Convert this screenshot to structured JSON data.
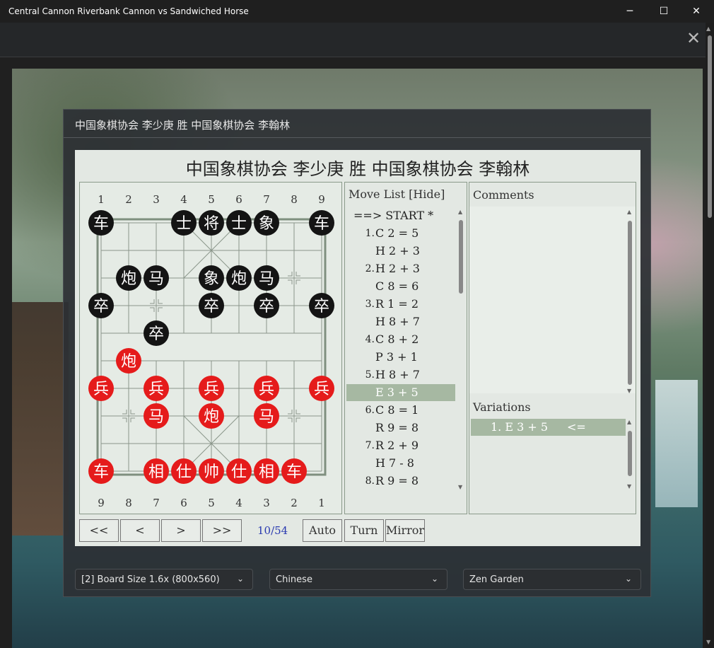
{
  "window": {
    "title": "Central Cannon Riverbank Cannon vs Sandwiched Horse",
    "minimize_glyph": "─",
    "maximize_glyph": "☐",
    "close_glyph": "✕"
  },
  "viewer": {
    "close_glyph": "✕",
    "dialog_title": "中国象棋协会 李少庚 胜 中国象棋协会 李翰林",
    "game_title": "中国象棋协会 李少庚 胜 中国象棋协会 李翰林"
  },
  "board": {
    "top_labels": [
      "1",
      "2",
      "3",
      "4",
      "5",
      "6",
      "7",
      "8",
      "9"
    ],
    "bottom_labels": [
      "9",
      "8",
      "7",
      "6",
      "5",
      "4",
      "3",
      "2",
      "1"
    ],
    "pieces": [
      {
        "color": "black",
        "char": "车",
        "file": 0,
        "rank": 0
      },
      {
        "color": "black",
        "char": "士",
        "file": 3,
        "rank": 0
      },
      {
        "color": "black",
        "char": "将",
        "file": 4,
        "rank": 0
      },
      {
        "color": "black",
        "char": "士",
        "file": 5,
        "rank": 0
      },
      {
        "color": "black",
        "char": "象",
        "file": 6,
        "rank": 0
      },
      {
        "color": "black",
        "char": "车",
        "file": 8,
        "rank": 0
      },
      {
        "color": "black",
        "char": "炮",
        "file": 1,
        "rank": 2
      },
      {
        "color": "black",
        "char": "马",
        "file": 2,
        "rank": 2
      },
      {
        "color": "black",
        "char": "象",
        "file": 4,
        "rank": 2
      },
      {
        "color": "black",
        "char": "炮",
        "file": 5,
        "rank": 2
      },
      {
        "color": "black",
        "char": "马",
        "file": 6,
        "rank": 2
      },
      {
        "color": "black",
        "char": "卒",
        "file": 0,
        "rank": 3
      },
      {
        "color": "black",
        "char": "卒",
        "file": 4,
        "rank": 3
      },
      {
        "color": "black",
        "char": "卒",
        "file": 6,
        "rank": 3
      },
      {
        "color": "black",
        "char": "卒",
        "file": 8,
        "rank": 3
      },
      {
        "color": "black",
        "char": "卒",
        "file": 2,
        "rank": 4
      },
      {
        "color": "red",
        "char": "炮",
        "file": 1,
        "rank": 5
      },
      {
        "color": "red",
        "char": "兵",
        "file": 0,
        "rank": 6
      },
      {
        "color": "red",
        "char": "兵",
        "file": 2,
        "rank": 6
      },
      {
        "color": "red",
        "char": "兵",
        "file": 4,
        "rank": 6
      },
      {
        "color": "red",
        "char": "兵",
        "file": 6,
        "rank": 6
      },
      {
        "color": "red",
        "char": "兵",
        "file": 8,
        "rank": 6
      },
      {
        "color": "red",
        "char": "马",
        "file": 2,
        "rank": 7
      },
      {
        "color": "red",
        "char": "炮",
        "file": 4,
        "rank": 7
      },
      {
        "color": "red",
        "char": "马",
        "file": 6,
        "rank": 7
      },
      {
        "color": "red",
        "char": "车",
        "file": 0,
        "rank": 9
      },
      {
        "color": "red",
        "char": "相",
        "file": 2,
        "rank": 9
      },
      {
        "color": "red",
        "char": "仕",
        "file": 3,
        "rank": 9
      },
      {
        "color": "red",
        "char": "帅",
        "file": 4,
        "rank": 9
      },
      {
        "color": "red",
        "char": "仕",
        "file": 5,
        "rank": 9
      },
      {
        "color": "red",
        "char": "相",
        "file": 6,
        "rank": 9
      },
      {
        "color": "red",
        "char": "车",
        "file": 7,
        "rank": 9
      }
    ],
    "markers": [
      {
        "file": 2,
        "rank": 3
      },
      {
        "file": 7,
        "rank": 2
      },
      {
        "file": 1,
        "rank": 7
      },
      {
        "file": 7,
        "rank": 7
      }
    ]
  },
  "move_list": {
    "header": "Move List [Hide]",
    "start_label": "==> START *",
    "rows": [
      {
        "num": "1.",
        "move": "C 2 = 5",
        "selected": false
      },
      {
        "num": "",
        "move": "H 2 + 3",
        "selected": false
      },
      {
        "num": "2.",
        "move": "H 2 + 3",
        "selected": false
      },
      {
        "num": "",
        "move": "C 8 = 6",
        "selected": false
      },
      {
        "num": "3.",
        "move": "R 1 = 2",
        "selected": false
      },
      {
        "num": "",
        "move": "H 8 + 7",
        "selected": false
      },
      {
        "num": "4.",
        "move": "C 8 + 2",
        "selected": false
      },
      {
        "num": "",
        "move": "P 3 + 1",
        "selected": false
      },
      {
        "num": "5.",
        "move": "H 8 + 7",
        "selected": false
      },
      {
        "num": "",
        "move": "E 3 + 5",
        "selected": true
      },
      {
        "num": "6.",
        "move": "C 8 = 1",
        "selected": false
      },
      {
        "num": "",
        "move": "R 9 = 8",
        "selected": false
      },
      {
        "num": "7.",
        "move": "R 2 + 9",
        "selected": false
      },
      {
        "num": "",
        "move": "H 7 - 8",
        "selected": false
      },
      {
        "num": "8.",
        "move": "R 9 = 8",
        "selected": false
      }
    ]
  },
  "comments": {
    "header": "Comments",
    "text": ""
  },
  "variations": {
    "header": "Variations",
    "items": [
      {
        "move": "1. E 3 + 5",
        "arrow": "<="
      }
    ]
  },
  "navigation": {
    "first": "<<",
    "prev": "<",
    "next": ">",
    "last": ">>",
    "counter": "10/54",
    "auto": "Auto",
    "turn": "Turn",
    "mirror": "Mirror"
  },
  "settings": {
    "board_size": "[2] Board Size 1.6x (800x560)",
    "piece_style": "Chinese",
    "theme": "Zen Garden",
    "chevron_glyph": "⌄"
  },
  "colors": {
    "red_piece": "#e51b1b",
    "black_piece": "#141414",
    "selected_row": "#a6b8a2",
    "counter_text": "#2a3ab0"
  }
}
